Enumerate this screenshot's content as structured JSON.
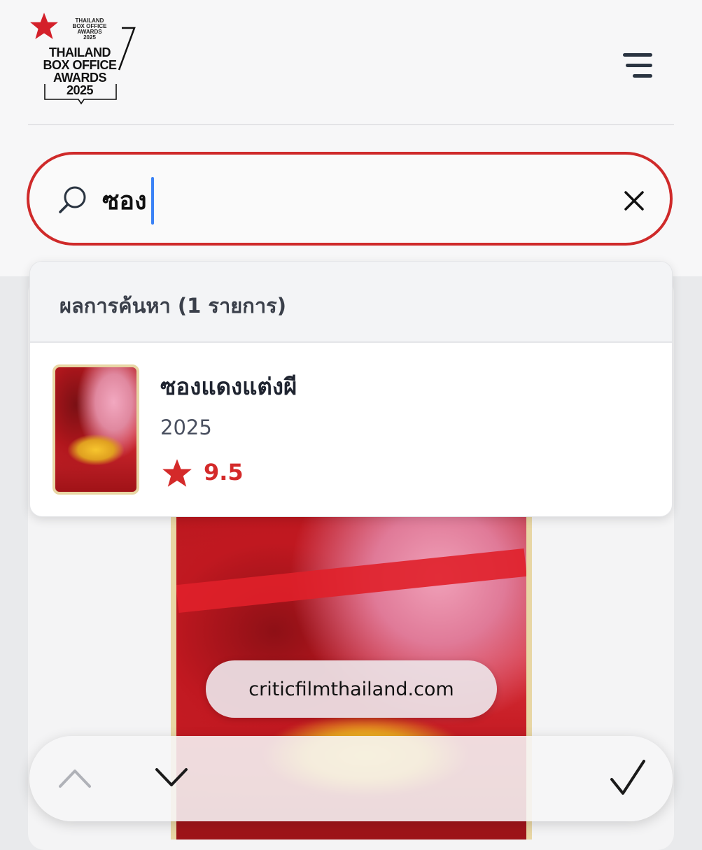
{
  "logo": {
    "small_text": [
      "THAILAND",
      "BOX OFFICE",
      "AWARDS",
      "2025"
    ],
    "big_text": [
      "THAILAND",
      "BOX OFFICE",
      "AWARDS"
    ],
    "year": "2025"
  },
  "search": {
    "value": "ซอง"
  },
  "results": {
    "count_label": "ผลการค้นหา (1 รายการ)",
    "items": [
      {
        "title": "ซองแดงแต่งผี",
        "year": "2025",
        "rating": "9.5"
      }
    ]
  },
  "url_bar": {
    "domain": "criticfilmthailand.com"
  },
  "colors": {
    "accent": "#cf2a2a",
    "rating": "#d42a2a",
    "caret": "#3b82f6"
  }
}
